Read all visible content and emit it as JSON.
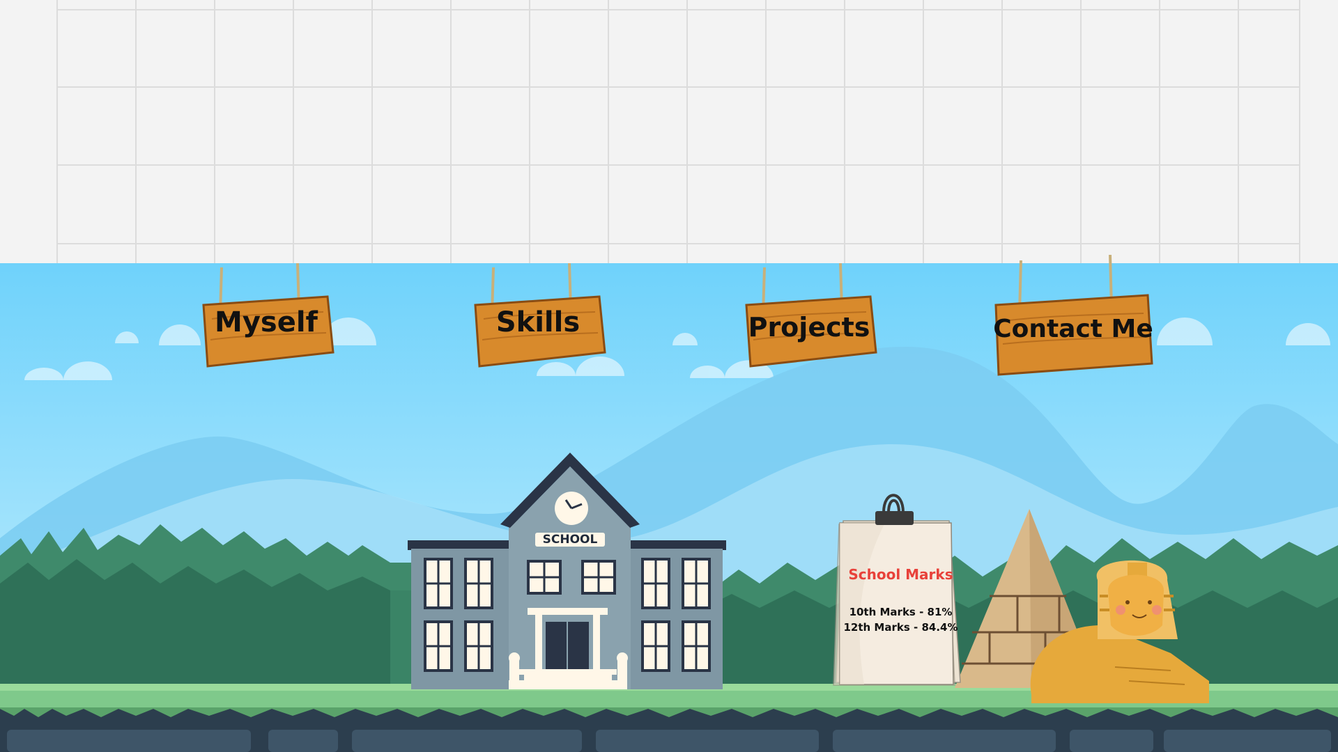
{
  "nav": {
    "items": [
      {
        "label": "Myself"
      },
      {
        "label": "Skills"
      },
      {
        "label": "Projects"
      },
      {
        "label": "Contact Me"
      }
    ]
  },
  "school": {
    "label": "SCHOOL"
  },
  "marks": {
    "title": "School Marks",
    "lines": [
      "10th Marks - 81%",
      "12th Marks - 84.4%"
    ]
  },
  "colors": {
    "sky": "#86d6f5",
    "wood": "#d88a2c",
    "grass": "#4f9a67",
    "marks_title": "#e8413a"
  }
}
